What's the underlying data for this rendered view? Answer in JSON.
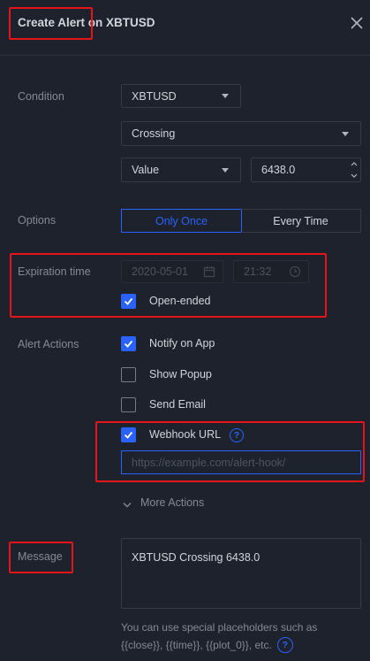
{
  "header": {
    "title": "Create Alert on XBTUSD"
  },
  "condition": {
    "label": "Condition",
    "symbol": "XBTUSD",
    "operator": "Crossing",
    "value_type": "Value",
    "value": "6438.0"
  },
  "options": {
    "label": "Options",
    "tabs": [
      "Only Once",
      "Every Time"
    ],
    "selected": "Only Once"
  },
  "expiration": {
    "label": "Expiration time",
    "date": "2020-05-01",
    "time": "21:32",
    "open_ended_label": "Open-ended",
    "open_ended_checked": true
  },
  "actions": {
    "label": "Alert Actions",
    "notify_app_label": "Notify on App",
    "notify_app_checked": true,
    "show_popup_label": "Show Popup",
    "show_popup_checked": false,
    "send_email_label": "Send Email",
    "send_email_checked": false,
    "webhook_label": "Webhook URL",
    "webhook_checked": true,
    "webhook_placeholder": "https://example.com/alert-hook/",
    "more_label": "More Actions"
  },
  "message": {
    "label": "Message",
    "text": "XBTUSD Crossing 6438.0",
    "hint_line1": "You can use special placeholders such as",
    "hint_line2": "{{close}}, {{time}}, {{plot_0}}, etc."
  },
  "colors": {
    "accent": "#2962ff",
    "annotation_red": "#e4141a",
    "background": "#1e222d"
  }
}
